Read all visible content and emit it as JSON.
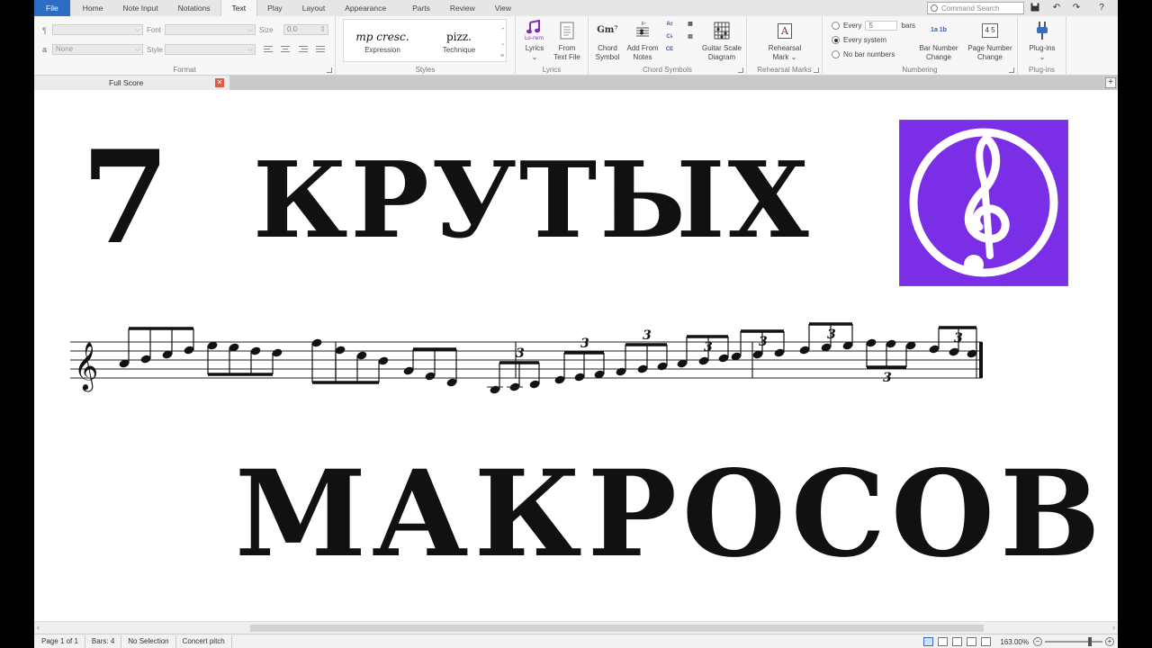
{
  "tabs": [
    "File",
    "Home",
    "Note Input",
    "Notations",
    "Text",
    "Play",
    "Layout",
    "Appearance",
    "Parts",
    "Review",
    "View"
  ],
  "active_tab": "Text",
  "search": {
    "placeholder": "Command Search"
  },
  "format": {
    "paragraph_symbol": "¶",
    "a_symbol": "a",
    "font_label": "Font",
    "size_label": "Size",
    "size_value": "0.0",
    "style_label": "Style",
    "none_value": "None",
    "group_label": "Format"
  },
  "styles": {
    "expression": {
      "main": "mp cresc.",
      "label": "Expression"
    },
    "technique": {
      "main": "pizz.",
      "label": "Technique"
    },
    "group_label": "Styles"
  },
  "lyrics": {
    "lyrics_icon_text": "Lo-rem",
    "lyrics_label": "Lyrics",
    "from_text_file_label": "From Text File",
    "group_label": "Lyrics"
  },
  "chord_symbols": {
    "chord_icon_text": "Gm⁷",
    "chord_symbol_label": "Chord Symbol",
    "add_from_notes_label": "Add From Notes",
    "guitar_scale_label": "Guitar Scale Diagram",
    "group_label": "Chord Symbols"
  },
  "rehearsal": {
    "icon_text": "A",
    "label": "Rehearsal Mark",
    "group_label": "Rehearsal Marks"
  },
  "numbering": {
    "every_label": "Every",
    "every_value": "5",
    "bars_label": "bars",
    "every_system_label": "Every system",
    "no_bar_numbers_label": "No bar numbers",
    "bar_number_change_label": "Bar Number Change",
    "bar_number_icon_text": "1a 1b",
    "page_number_change_label": "Page Number Change",
    "page_number_icon_text": "4 5",
    "group_label": "Numbering"
  },
  "plugins": {
    "label": "Plug-ins",
    "group_label": "Plug-ins"
  },
  "document": {
    "tab_label": "Full Score",
    "close_glyph": "✕",
    "plus_glyph": "+"
  },
  "score": {
    "number": "7",
    "line1": "КРУТЫХ",
    "line2": "МАКРОСОВ",
    "tuplet_label": "3"
  },
  "status_bar": {
    "page": "Page 1 of 1",
    "bars": "Bars: 4",
    "selection": "No Selection",
    "pitch": "Concert pitch",
    "zoom": "163.00%"
  },
  "colors": {
    "file_tab": "#2b6cc4",
    "logo_bg": "#7a2fe6",
    "close_button": "#e05a4a"
  }
}
